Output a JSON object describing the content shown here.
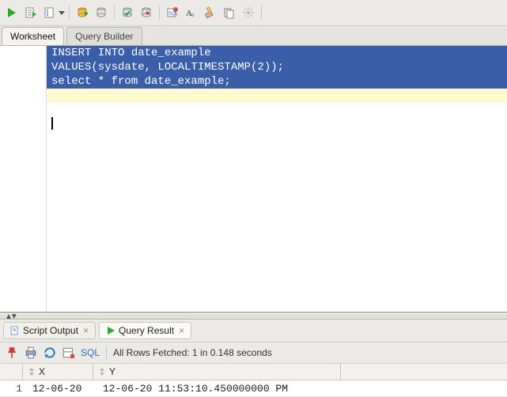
{
  "toolbar": {
    "icons": [
      "run",
      "script",
      "script-dd",
      "export",
      "save",
      "commit",
      "rollback",
      "explain-sql",
      "find",
      "clear",
      "history",
      "settings"
    ]
  },
  "tabs": {
    "worksheet": "Worksheet",
    "query_builder": "Query Builder"
  },
  "editor": {
    "lines": [
      "INSERT INTO date_example",
      "VALUES(sysdate, LOCALTIMESTAMP(2));",
      "",
      "select * from date_example;"
    ]
  },
  "result_tabs": {
    "script_output": {
      "label": "Script Output"
    },
    "query_result": {
      "label": "Query Result"
    }
  },
  "result_toolbar": {
    "sql_label": "SQL",
    "status": "All Rows Fetched: 1 in 0.148 seconds"
  },
  "grid": {
    "columns": [
      "X",
      "Y"
    ],
    "rows": [
      {
        "n": "1",
        "x": "12-06-20",
        "y": "12-06-20 11:53:10.450000000 PM"
      }
    ]
  }
}
